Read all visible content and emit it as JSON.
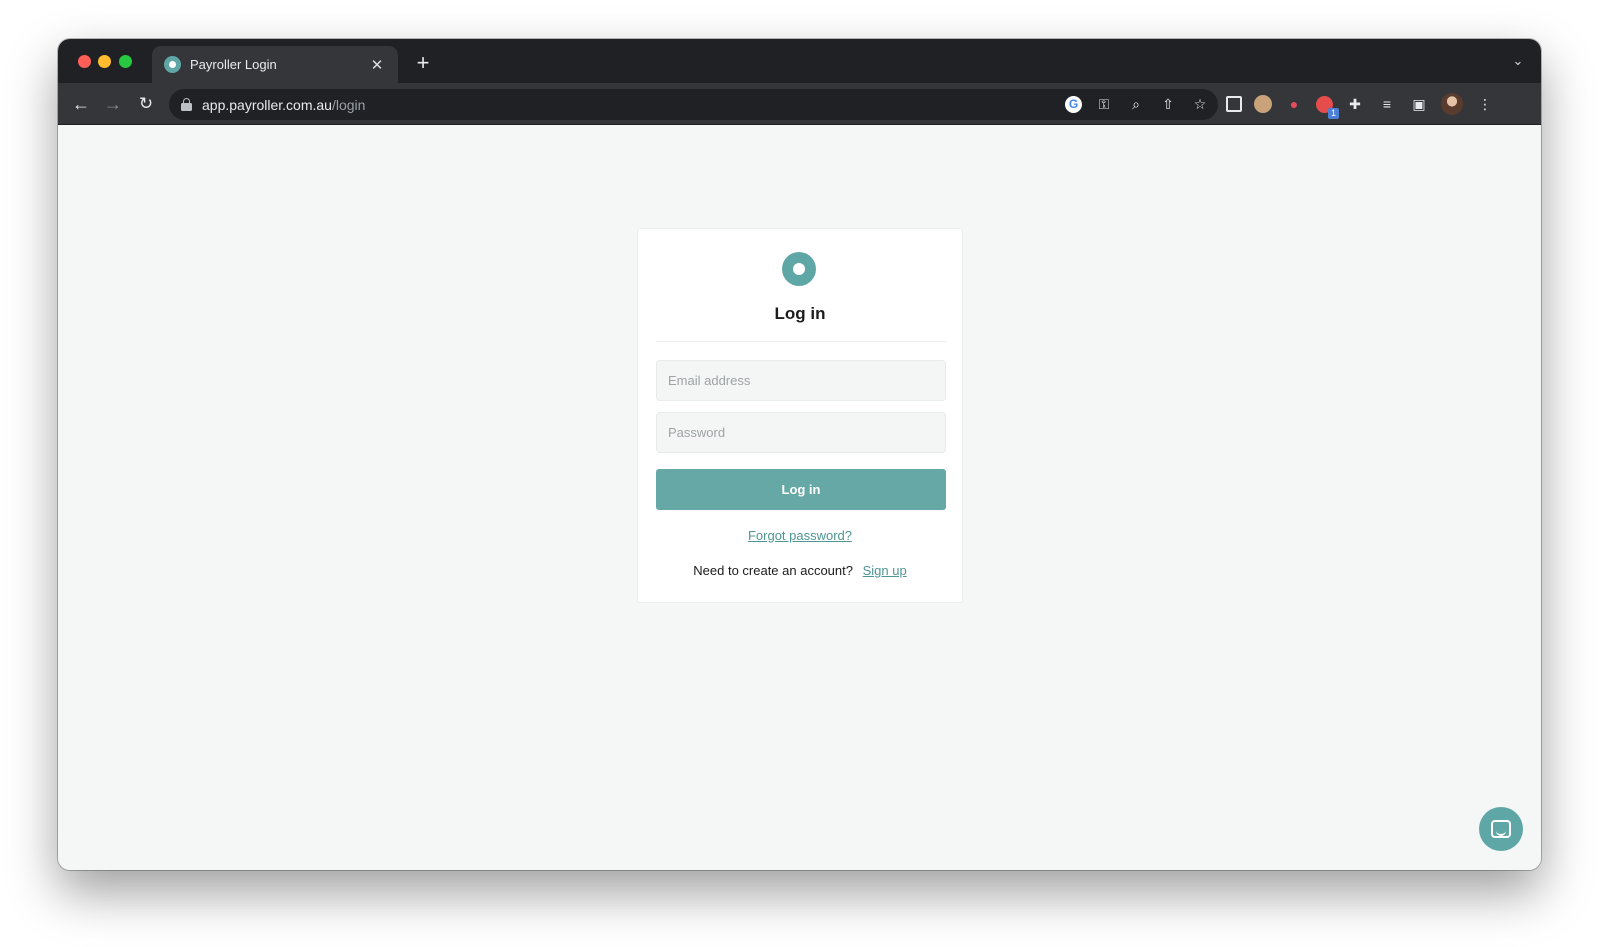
{
  "browser": {
    "tab": {
      "title": "Payroller Login",
      "close_glyph": "✕"
    },
    "new_tab_glyph": "+",
    "tab_search_glyph": "⌄",
    "nav": {
      "back_glyph": "←",
      "forward_glyph": "→",
      "reload_glyph": "↻"
    },
    "url": {
      "host": "app.payroller.com.au",
      "path": "/login"
    },
    "omnibox_icons": [
      "google-icon",
      "key-icon",
      "zoom-icon",
      "share-icon",
      "star-icon"
    ],
    "extensions": [
      "qr-code-icon",
      "face-extension-icon",
      "bell-extension-icon",
      "red-extension-icon",
      "puzzle-icon",
      "reading-list-icon",
      "side-panel-icon",
      "profile-avatar",
      "kebab-menu-icon"
    ],
    "extension_badge": "1"
  },
  "login": {
    "title": "Log in",
    "email_placeholder": "Email address",
    "password_placeholder": "Password",
    "submit_label": "Log in",
    "forgot_label": "Forgot password?",
    "signup_prompt": "Need to create an account?",
    "signup_label": "Sign up"
  },
  "colors": {
    "brand": "#5fa7a6",
    "button": "#66a8a6",
    "link": "#4e9593",
    "page_bg": "#f5f7f7"
  }
}
